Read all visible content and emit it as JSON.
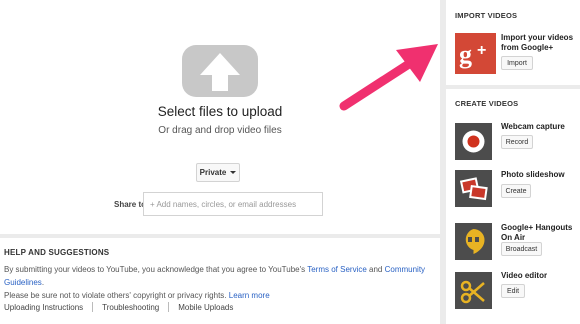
{
  "upload": {
    "title": "Select files to upload",
    "subtitle": "Or drag and drop video files",
    "privacy_value": "Private",
    "share_label": "Share to:",
    "share_placeholder": "+ Add names, circles, or email addresses"
  },
  "help": {
    "heading": "HELP AND SUGGESTIONS",
    "text_part1": "By submitting your videos to YouTube, you acknowledge that you agree to YouTube's ",
    "terms_link": "Terms of Service",
    "text_and": " and ",
    "guidelines_link": "Community Guidelines",
    "text_part2": ".",
    "text_line2": "Please be sure not to violate others' copyright or privacy rights. ",
    "learn_more": "Learn more",
    "links": [
      "Uploading Instructions",
      "Troubleshooting",
      "Mobile Uploads"
    ]
  },
  "import": {
    "heading": "IMPORT VIDEOS",
    "item_title": "Import your videos from Google+",
    "button": "Import",
    "icon": "google-plus-icon",
    "accent": "#d34836"
  },
  "create": {
    "heading": "CREATE VIDEOS",
    "items": [
      {
        "title": "Webcam capture",
        "button": "Record",
        "icon": "record-icon"
      },
      {
        "title": "Photo slideshow",
        "button": "Create",
        "icon": "photos-icon"
      },
      {
        "title": "Google+ Hangouts On Air",
        "button": "Broadcast",
        "icon": "hangouts-icon"
      },
      {
        "title": "Video editor",
        "button": "Edit",
        "icon": "scissors-icon"
      }
    ]
  },
  "colors": {
    "link": "#2a62c4",
    "arrow": "#f0306f",
    "hangouts": "#e8b323"
  }
}
